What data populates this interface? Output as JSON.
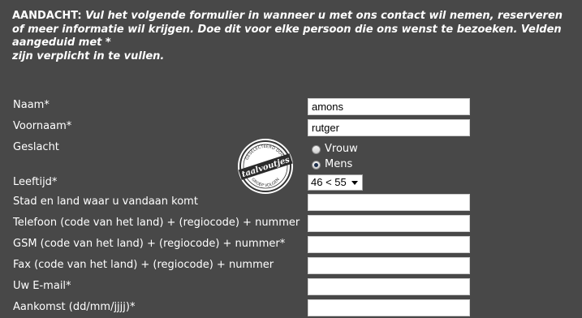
{
  "notice": {
    "lead": "AANDACHT:",
    "body": " Vul het volgende formulier in wanneer u met ons contact wil nemen, reserveren of meer informatie wil krijgen. Doe dit voor elke persoon die ons wenst te bezoeken. Velden aangeduid met *",
    "body2": "zijn verplicht in te vullen."
  },
  "form": {
    "naam": {
      "label": "Naam*",
      "value": "amons"
    },
    "voornaam": {
      "label": "Voornaam*",
      "value": "rutger"
    },
    "geslacht": {
      "label": "Geslacht",
      "options": [
        {
          "label": "Vrouw",
          "checked": false
        },
        {
          "label": "Mens",
          "checked": true
        }
      ]
    },
    "leeftijd": {
      "label": "Leeftijd*",
      "selected": "46 < 55"
    },
    "stad": {
      "label": "Stad en land waar u vandaan komt",
      "value": ""
    },
    "telefoon": {
      "label": "Telefoon (code van het land) + (regiocode) + nummer",
      "value": ""
    },
    "gsm": {
      "label": "GSM (code van het land) + (regiocode) + nummer*",
      "value": ""
    },
    "fax": {
      "label": "Fax (code van het land) + (regiocode) + nummer",
      "value": ""
    },
    "email": {
      "label": "Uw E-mail*",
      "value": ""
    },
    "aankomst": {
      "label": "Aankomst (dd/mm/jjjj)*",
      "value": ""
    }
  },
  "stamp": {
    "top_text": "GESELECTEERD DOOR",
    "main_text": "taalvoutjes",
    "bottom_text": "GROEP VOLGEN"
  },
  "colors": {
    "background": "#484848",
    "text": "#ffffff",
    "field": "#ffffff"
  }
}
